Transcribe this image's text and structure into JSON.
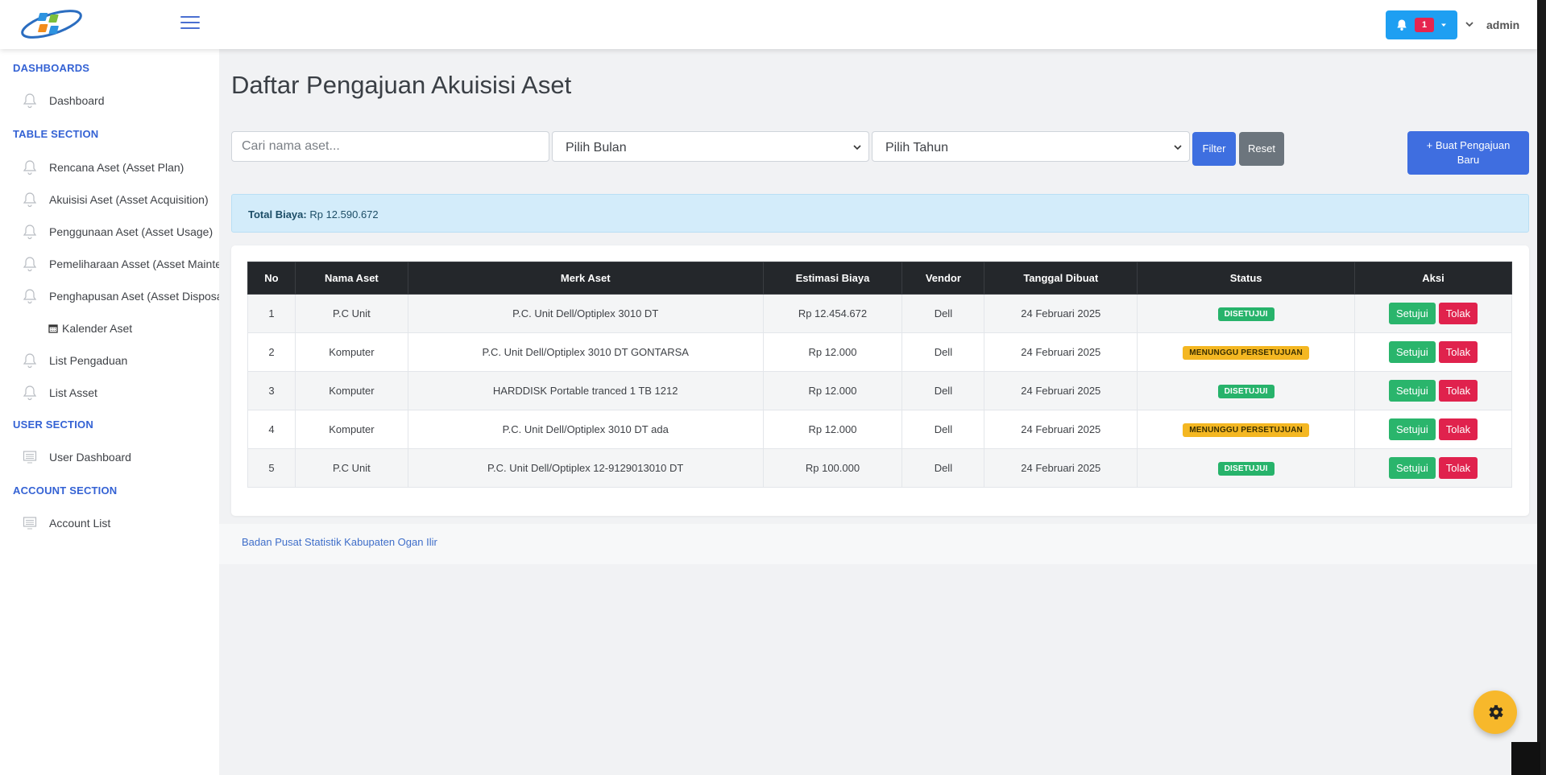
{
  "header": {
    "logo_icon": "bps-logo",
    "menu_icon": "hamburger-icon",
    "notification_count": "1",
    "user_name": "admin"
  },
  "sidebar": {
    "sections": [
      {
        "title": "DASHBOARDS",
        "items": [
          {
            "label": "Dashboard",
            "icon": "bell-outline-icon"
          }
        ]
      },
      {
        "title": "TABLE SECTION",
        "items": [
          {
            "label": "Rencana Aset (Asset Plan)",
            "icon": "bell-outline-icon"
          },
          {
            "label": "Akuisisi Aset (Asset Acquisition)",
            "icon": "bell-outline-icon"
          },
          {
            "label": "Penggunaan Aset (Asset Usage)",
            "icon": "bell-outline-icon"
          },
          {
            "label": "Pemeliharaan Asset (Asset Maintenance)",
            "icon": "bell-outline-icon"
          },
          {
            "label": "Penghapusan Aset (Asset Disposal)",
            "icon": "bell-outline-icon"
          },
          {
            "label": "Kalender Aset",
            "icon": "calendar-icon"
          },
          {
            "label": "List Pengaduan",
            "icon": "bell-outline-icon"
          },
          {
            "label": "List Asset",
            "icon": "bell-outline-icon"
          }
        ]
      },
      {
        "title": "USER SECTION",
        "items": [
          {
            "label": "User Dashboard",
            "icon": "monitor-icon"
          }
        ]
      },
      {
        "title": "ACCOUNT SECTION",
        "items": [
          {
            "label": "Account List",
            "icon": "monitor-icon"
          }
        ]
      }
    ]
  },
  "main": {
    "title": "Daftar Pengajuan Akuisisi Aset",
    "search_placeholder": "Cari nama aset...",
    "month_select": "Pilih Bulan",
    "year_select": "Pilih Tahun",
    "filter_label": "Filter",
    "reset_label": "Reset",
    "new_button_label": "+ Buat Pengajuan Baru",
    "total_label": "Total Biaya:",
    "total_value": "Rp 12.590.672",
    "table": {
      "headers": [
        "No",
        "Nama Aset",
        "Merk Aset",
        "Estimasi Biaya",
        "Vendor",
        "Tanggal Dibuat",
        "Status",
        "Aksi"
      ],
      "rows": [
        {
          "no": "1",
          "nama": "P.C Unit",
          "merk": "P.C. Unit Dell/Optiplex 3010 DT",
          "biaya": "Rp 12.454.672",
          "vendor": "Dell",
          "tanggal": "24 Februari 2025",
          "status": "DISETUJUI"
        },
        {
          "no": "2",
          "nama": "Komputer",
          "merk": "P.C. Unit Dell/Optiplex 3010 DT GONTARSA",
          "biaya": "Rp 12.000",
          "vendor": "Dell",
          "tanggal": "24 Februari 2025",
          "status": "MENUNGGU PERSETUJUAN"
        },
        {
          "no": "3",
          "nama": "Komputer",
          "merk": "HARDDISK Portable tranced 1 TB 1212",
          "biaya": "Rp 12.000",
          "vendor": "Dell",
          "tanggal": "24 Februari 2025",
          "status": "DISETUJUI"
        },
        {
          "no": "4",
          "nama": "Komputer",
          "merk": "P.C. Unit Dell/Optiplex 3010 DT ada",
          "biaya": "Rp 12.000",
          "vendor": "Dell",
          "tanggal": "24 Februari 2025",
          "status": "MENUNGGU PERSETUJUAN"
        },
        {
          "no": "5",
          "nama": "P.C Unit",
          "merk": "P.C. Unit Dell/Optiplex 12-9129013010 DT",
          "biaya": "Rp 100.000",
          "vendor": "Dell",
          "tanggal": "24 Februari 2025",
          "status": "DISETUJUI"
        }
      ],
      "approve_label": "Setujui",
      "reject_label": "Tolak"
    }
  },
  "footer": {
    "text": "Badan Pusat Statistik Kabupaten Ogan Ilir"
  },
  "settings_icon": "gear-icon",
  "colors": {
    "primary": "#3f6ee0",
    "section_title": "#3462d4",
    "approved": "#27b36b",
    "pending": "#f4b722",
    "reject": "#e0224d",
    "table_header": "#24272b",
    "info_bg": "#d3ecfa",
    "fab": "#f7b82b"
  }
}
